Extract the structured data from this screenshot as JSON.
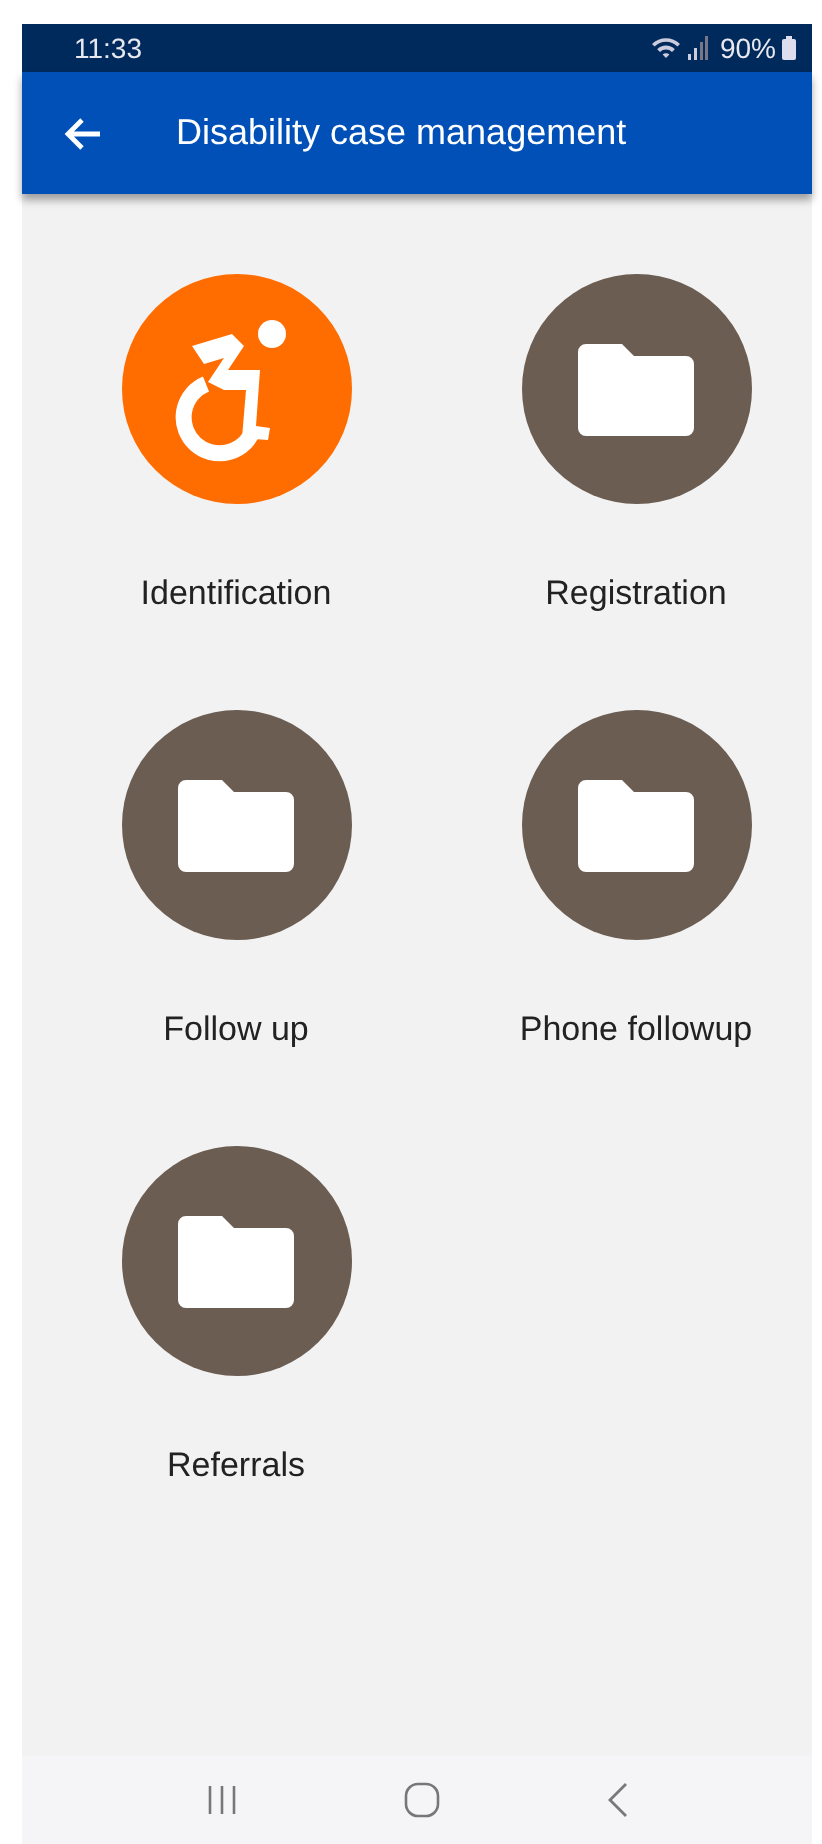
{
  "status_bar": {
    "time": "11:33",
    "battery": "90%"
  },
  "app_bar": {
    "title": "Disability case management"
  },
  "tiles": [
    {
      "kind": "wheelchair",
      "label": "Identification"
    },
    {
      "kind": "folder",
      "label": "Registration"
    },
    {
      "kind": "folder",
      "label": "Follow up"
    },
    {
      "kind": "folder",
      "label": "Phone followup"
    },
    {
      "kind": "folder",
      "label": "Referrals"
    }
  ]
}
